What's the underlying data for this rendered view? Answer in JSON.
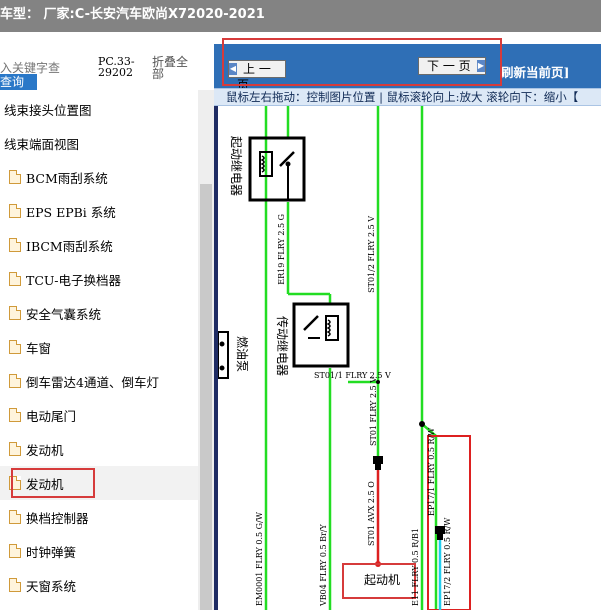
{
  "title": "车型：  厂家:C-长安汽车欧尚X72020-2021",
  "left_panel": {
    "search_placeholder": "入关键字查",
    "search_button": "查询",
    "pc_code": "PC.33-29202",
    "collapse_all": "折叠全部",
    "items": [
      {
        "label": "线束接头位置图",
        "icon": false,
        "selected": false
      },
      {
        "label": "线束端面视图",
        "icon": false,
        "selected": false
      },
      {
        "label": "BCM雨刮系统",
        "icon": true,
        "selected": false
      },
      {
        "label": "EPS EPBi 系统",
        "icon": true,
        "selected": false
      },
      {
        "label": "IBCM雨刮系统",
        "icon": true,
        "selected": false
      },
      {
        "label": "TCU-电子换档器",
        "icon": true,
        "selected": false
      },
      {
        "label": "安全气囊系统",
        "icon": true,
        "selected": false
      },
      {
        "label": "车窗",
        "icon": true,
        "selected": false
      },
      {
        "label": "倒车雷达4通道、倒车灯",
        "icon": true,
        "selected": false
      },
      {
        "label": "电动尾门",
        "icon": true,
        "selected": false
      },
      {
        "label": "发动机",
        "icon": true,
        "selected": false
      },
      {
        "label": "发动机",
        "icon": true,
        "selected": true
      },
      {
        "label": "换档控制器",
        "icon": true,
        "selected": false
      },
      {
        "label": "时钟弹簧",
        "icon": true,
        "selected": false
      },
      {
        "label": "天窗系统",
        "icon": true,
        "selected": false
      }
    ]
  },
  "viewer": {
    "prev_page": "上 一 页",
    "next_page": "下 一 页",
    "refresh": "刷新当前页]",
    "hint": "鼠标左右拖动：控制图片位置 | 鼠标滚轮向上:放大  滚轮向下：缩小【"
  },
  "diagram": {
    "start_relay": "起动继电器",
    "transmission_relay": "传动继电器",
    "fuel_pump": "燃油泵",
    "starter": "起动机",
    "wire_er19": "ER19 FLRY 2.5 G",
    "wire_st012": "ST01/2 FLRY 2.5 V",
    "wire_st011": "ST01/1 FLRY 2.5 V",
    "wire_st01_avx": "ST01 AVX 2.5 O",
    "wire_st01_flry": "ST01 FLRY 2.5 V",
    "wire_em": "EM0001 FLRY 0.5 G/W",
    "wire_vb04": "VB04 FLRY 0.5 Br/Y",
    "wire_vb_lower": "VB04 FLRY 0.5 Br/Y",
    "wire_ep": "EP17/1 FLRY 0.5 R/W",
    "wire_ep2": "EP17/2 FLRY 0.5 R/W",
    "wire_e11": "E11 FLRY 0.5 R/B1"
  },
  "colors": {
    "green_wire": "#22dd22",
    "red_wire": "#dd2020",
    "cyan_wire": "#22ccee",
    "title_bg": "#838383",
    "nav_bg": "#2f6fb6",
    "highlight": "#d63b3b"
  }
}
